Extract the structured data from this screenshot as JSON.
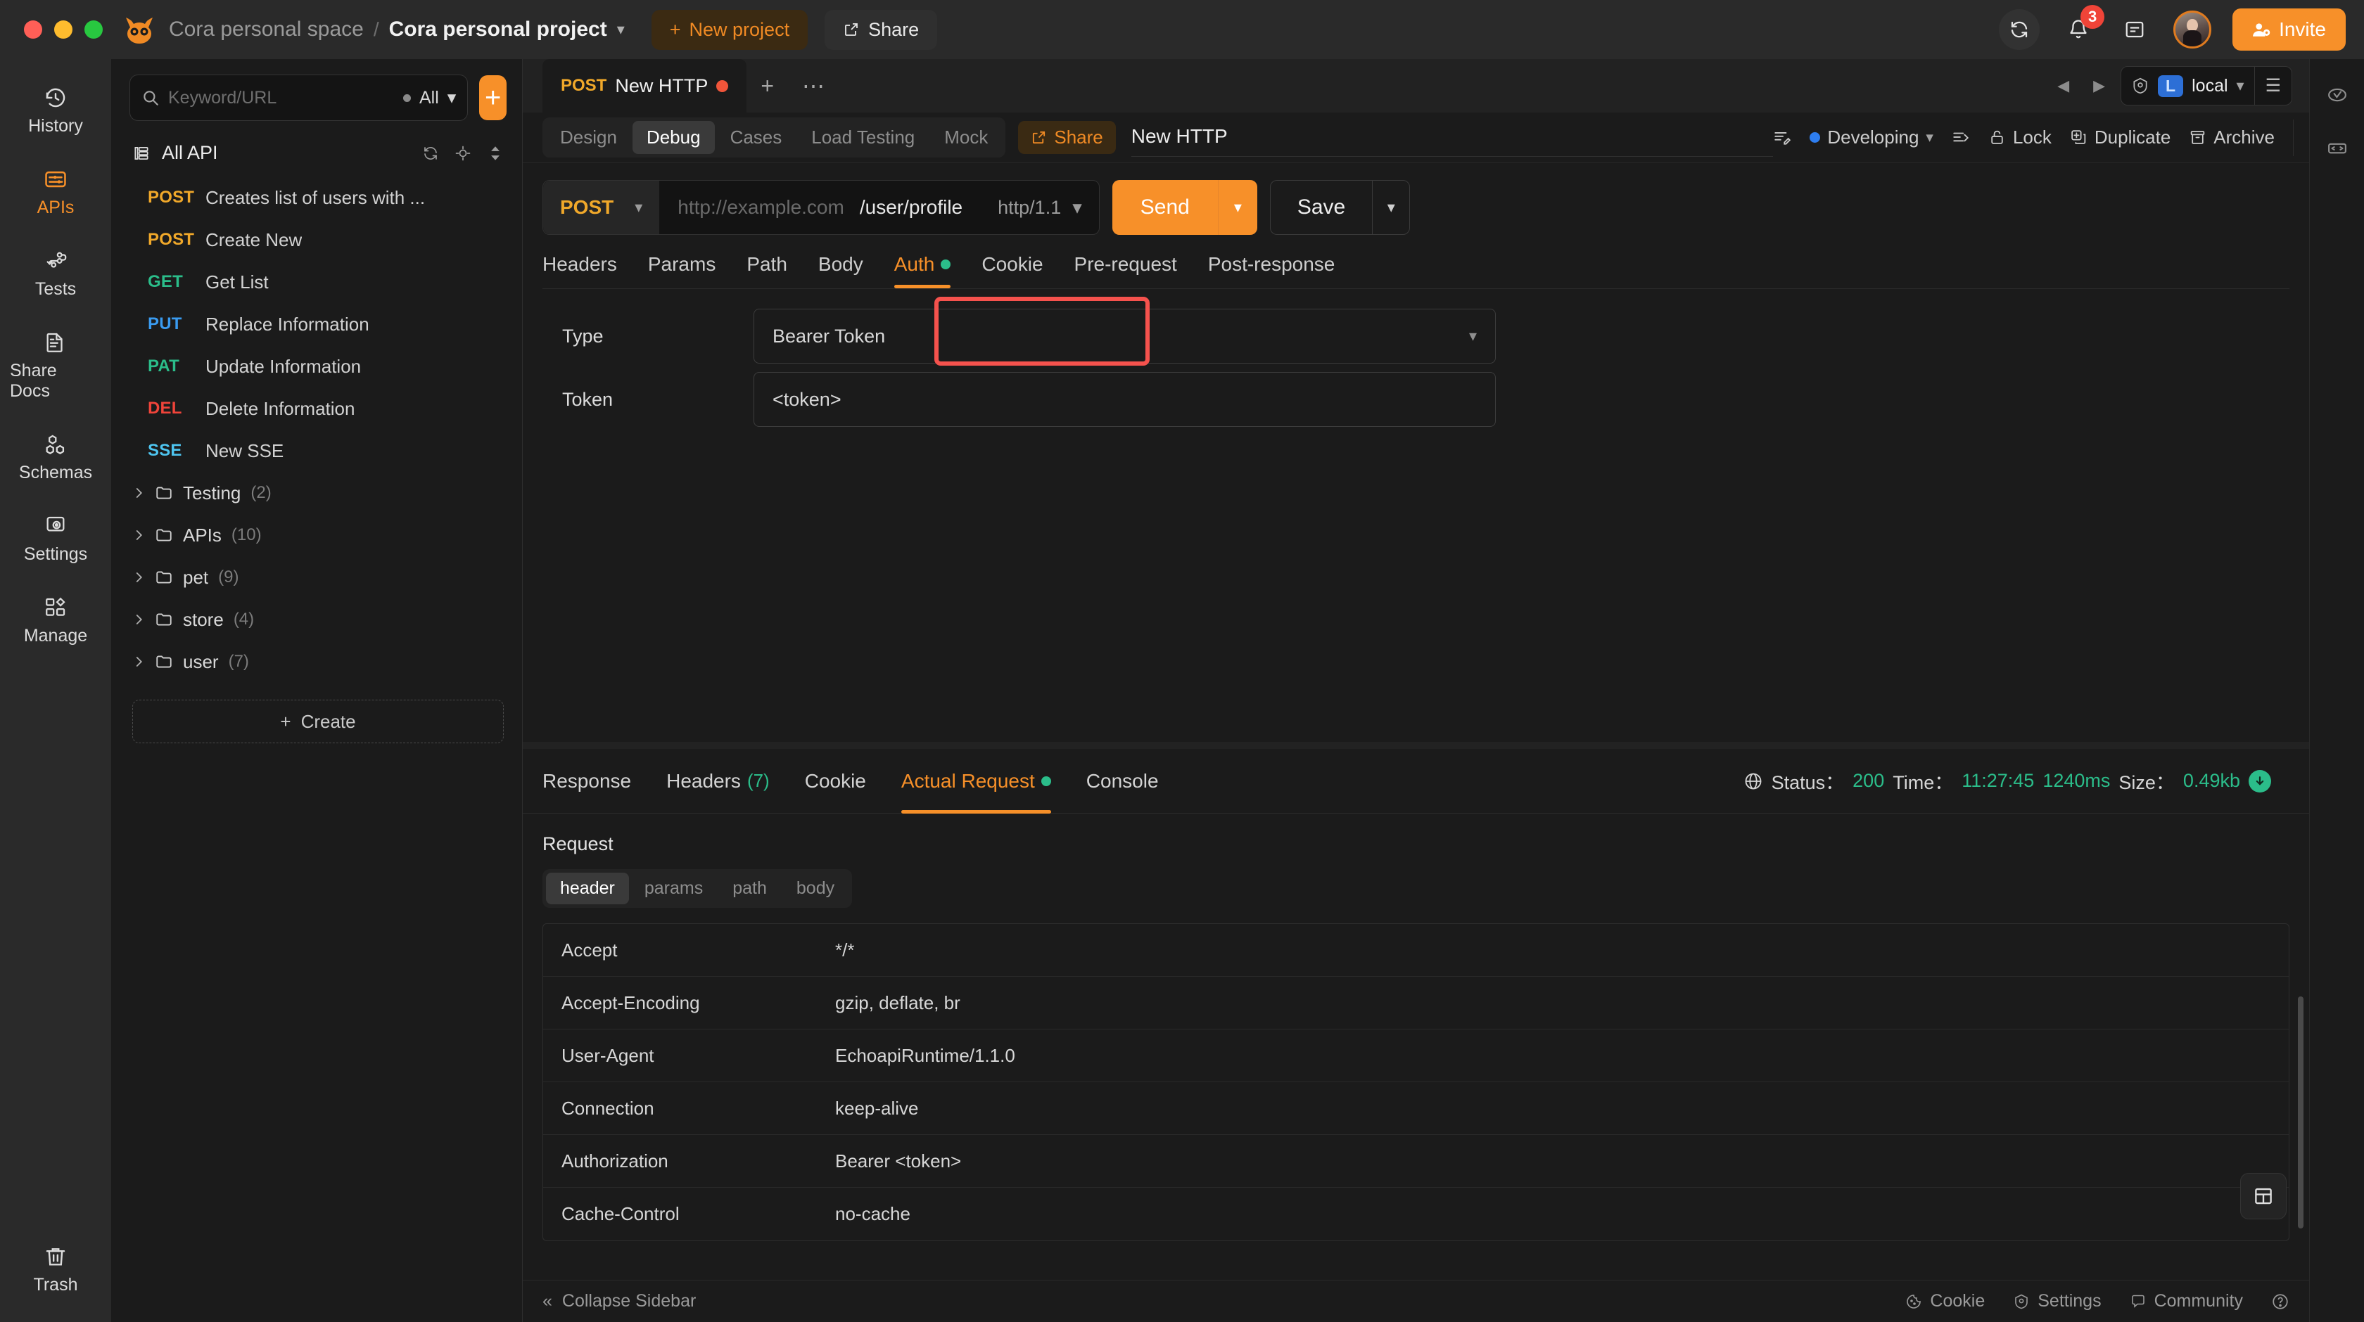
{
  "titlebar": {
    "space": "Cora personal space",
    "separator": "/",
    "project": "Cora personal project",
    "new_project": "New project",
    "share": "Share",
    "invite": "Invite",
    "notification_count": "3",
    "accent": "#f79029"
  },
  "rail": {
    "items": [
      {
        "label": "History",
        "icon": "history-icon",
        "active": false
      },
      {
        "label": "APIs",
        "icon": "apis-icon",
        "active": true
      },
      {
        "label": "Tests",
        "icon": "tests-icon",
        "active": false
      },
      {
        "label": "Share Docs",
        "icon": "share-docs-icon",
        "active": false
      },
      {
        "label": "Schemas",
        "icon": "schemas-icon",
        "active": false
      },
      {
        "label": "Settings",
        "icon": "settings-icon",
        "active": false
      },
      {
        "label": "Manage",
        "icon": "manage-icon",
        "active": false
      }
    ],
    "trash": {
      "label": "Trash",
      "icon": "trash-icon"
    }
  },
  "sidebar": {
    "search_placeholder": "Keyword/URL",
    "search_value": "",
    "filter_label": "All",
    "add_button": "+",
    "all_api_label": "All API",
    "apis": [
      {
        "method": "POST",
        "name": "Creates list of users with ...",
        "cls": "m-post"
      },
      {
        "method": "POST",
        "name": "Create New",
        "cls": "m-post"
      },
      {
        "method": "GET",
        "name": "Get List",
        "cls": "m-get"
      },
      {
        "method": "PUT",
        "name": "Replace Information",
        "cls": "m-put"
      },
      {
        "method": "PAT",
        "name": "Update Information",
        "cls": "m-pat"
      },
      {
        "method": "DEL",
        "name": "Delete Information",
        "cls": "m-del"
      },
      {
        "method": "SSE",
        "name": "New SSE",
        "cls": "m-sse"
      }
    ],
    "folders": [
      {
        "name": "Testing",
        "count": "(2)"
      },
      {
        "name": "APIs",
        "count": "(10)"
      },
      {
        "name": "pet",
        "count": "(9)"
      },
      {
        "name": "store",
        "count": "(4)"
      },
      {
        "name": "user",
        "count": "(7)"
      }
    ],
    "create_label": "Create"
  },
  "tabstrip": {
    "doc_method": "POST",
    "doc_name": "New HTTP",
    "plus": "+",
    "more": "⋯",
    "env_chip": "L",
    "env_name": "local"
  },
  "metarow": {
    "modes": [
      {
        "label": "Design",
        "active": false
      },
      {
        "label": "Debug",
        "active": true
      },
      {
        "label": "Cases",
        "active": false
      },
      {
        "label": "Load Testing",
        "active": false
      },
      {
        "label": "Mock",
        "active": false
      }
    ],
    "share_label": "Share",
    "request_title": "New HTTP",
    "status_label": "Developing",
    "lock_label": "Lock",
    "duplicate_label": "Duplicate",
    "archive_label": "Archive"
  },
  "urlbar": {
    "method": "POST",
    "host_placeholder": "http://example.com",
    "path": "/user/profile",
    "protocol": "http/1.1",
    "send_label": "Send",
    "save_label": "Save"
  },
  "request_tabs": [
    {
      "label": "Headers",
      "active": false,
      "dot": false
    },
    {
      "label": "Params",
      "active": false,
      "dot": false
    },
    {
      "label": "Path",
      "active": false,
      "dot": false
    },
    {
      "label": "Body",
      "active": false,
      "dot": false
    },
    {
      "label": "Auth",
      "active": true,
      "dot": true
    },
    {
      "label": "Cookie",
      "active": false,
      "dot": false
    },
    {
      "label": "Pre-request",
      "active": false,
      "dot": false
    },
    {
      "label": "Post-response",
      "active": false,
      "dot": false
    }
  ],
  "auth": {
    "type_label": "Type",
    "type_value": "Bearer Token",
    "token_label": "Token",
    "token_value": "<token>",
    "highlight_color": "#f5524d"
  },
  "response": {
    "tabs": [
      {
        "label": "Response",
        "count": "",
        "active": false,
        "dot": false
      },
      {
        "label": "Headers",
        "count": "(7)",
        "active": false,
        "dot": false
      },
      {
        "label": "Cookie",
        "count": "",
        "active": false,
        "dot": false
      },
      {
        "label": "Actual Request",
        "count": "",
        "active": true,
        "dot": true
      },
      {
        "label": "Console",
        "count": "",
        "active": false,
        "dot": false
      }
    ],
    "status_label": "Status：",
    "status_value": "200",
    "time_label": "Time：",
    "time_value": "11:27:45",
    "duration_value": "1240ms",
    "size_label": "Size：",
    "size_value": "0.49kb",
    "request_heading": "Request",
    "sub_tabs": [
      {
        "label": "header",
        "active": true
      },
      {
        "label": "params",
        "active": false
      },
      {
        "label": "path",
        "active": false
      },
      {
        "label": "body",
        "active": false
      }
    ],
    "headers": [
      {
        "key": "Accept",
        "value": "*/*"
      },
      {
        "key": "Accept-Encoding",
        "value": "gzip, deflate, br"
      },
      {
        "key": "User-Agent",
        "value": "EchoapiRuntime/1.1.0"
      },
      {
        "key": "Connection",
        "value": "keep-alive"
      },
      {
        "key": "Authorization",
        "value": "Bearer <token>"
      },
      {
        "key": "Cache-Control",
        "value": "no-cache"
      }
    ]
  },
  "footer": {
    "collapse_label": "Collapse Sidebar",
    "cookie_label": "Cookie",
    "settings_label": "Settings",
    "community_label": "Community"
  }
}
